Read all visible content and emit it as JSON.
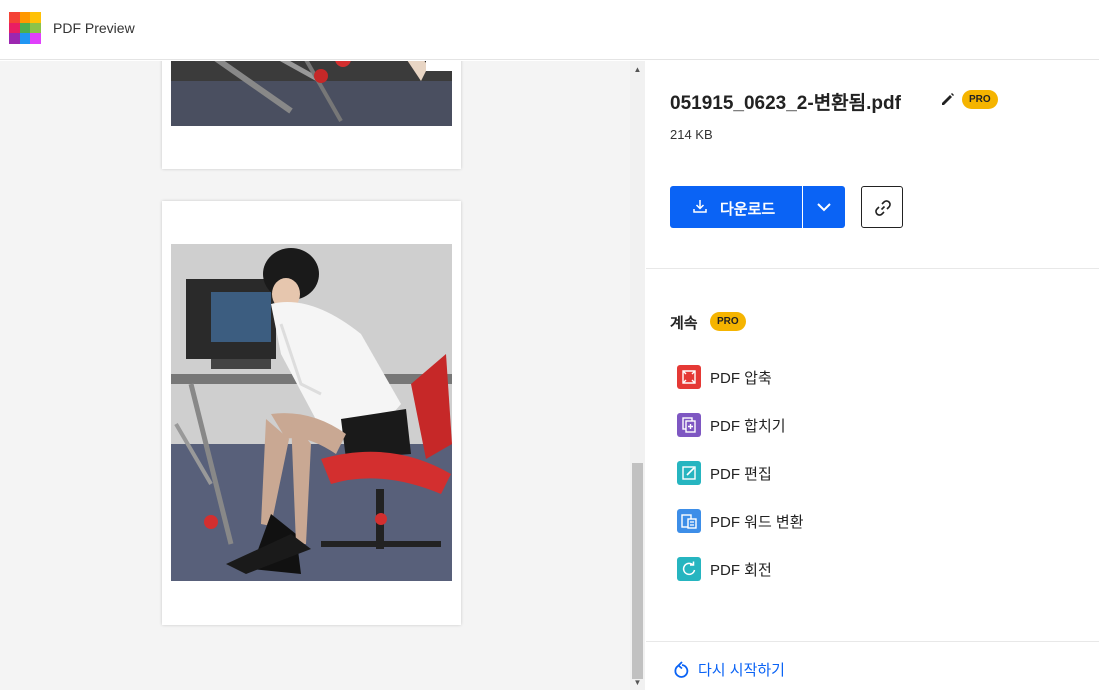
{
  "header": {
    "app_title": "PDF Preview",
    "logo_colors": [
      "#f44336",
      "#ff9800",
      "#ffc107",
      "#e91e63",
      "#4caf50",
      "#8bc34a",
      "#9c27b0",
      "#2196f3",
      "#e040fb"
    ]
  },
  "file": {
    "name": "051915_0623_2-변환됨.pdf",
    "badge": "PRO",
    "size": "214 KB"
  },
  "actions": {
    "download_label": "다운로드",
    "download_icon": "download-icon",
    "dropdown_icon": "chevron-down-icon",
    "link_icon": "link-icon",
    "accent": "#0a63f5"
  },
  "continue_section": {
    "title": "계속",
    "badge": "PRO",
    "tools": [
      {
        "label": "PDF 압축",
        "icon": "compress-icon",
        "color": "#e53935"
      },
      {
        "label": "PDF 합치기",
        "icon": "merge-icon",
        "color": "#7e57c2"
      },
      {
        "label": "PDF 편집",
        "icon": "edit-icon",
        "color": "#26b5c0"
      },
      {
        "label": "PDF 워드 변환",
        "icon": "word-convert-icon",
        "color": "#3d8ee8"
      },
      {
        "label": "PDF 회전",
        "icon": "rotate-icon",
        "color": "#26b5c0"
      }
    ]
  },
  "footer": {
    "restart_label": "다시 시작하기"
  },
  "scroll": {
    "position_fraction": 0.66
  }
}
